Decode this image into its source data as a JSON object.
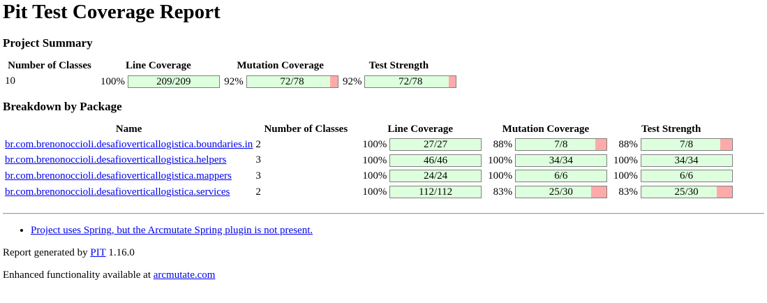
{
  "title": "Pit Test Coverage Report",
  "summary": {
    "heading": "Project Summary",
    "headers": {
      "classes": "Number of Classes",
      "line": "Line Coverage",
      "mutation": "Mutation Coverage",
      "strength": "Test Strength"
    },
    "num_classes": "10",
    "line_pct": "100%",
    "line_text": "209/209",
    "line_fraction": 1.0,
    "mutation_pct": "92%",
    "mutation_text": "72/78",
    "mutation_fraction": 0.923,
    "strength_pct": "92%",
    "strength_text": "72/78",
    "strength_fraction": 0.923
  },
  "breakdown": {
    "heading": "Breakdown by Package",
    "headers": {
      "name": "Name",
      "classes": "Number of Classes",
      "line": "Line Coverage",
      "mutation": "Mutation Coverage",
      "strength": "Test Strength"
    },
    "rows": [
      {
        "name": "br.com.brenonoccioli.desafioverticallogistica.boundaries.in",
        "classes": "2",
        "line_pct": "100%",
        "line_text": "27/27",
        "line_fraction": 1.0,
        "mutation_pct": "88%",
        "mutation_text": "7/8",
        "mutation_fraction": 0.875,
        "strength_pct": "88%",
        "strength_text": "7/8",
        "strength_fraction": 0.875
      },
      {
        "name": "br.com.brenonoccioli.desafioverticallogistica.helpers",
        "classes": "3",
        "line_pct": "100%",
        "line_text": "46/46",
        "line_fraction": 1.0,
        "mutation_pct": "100%",
        "mutation_text": "34/34",
        "mutation_fraction": 1.0,
        "strength_pct": "100%",
        "strength_text": "34/34",
        "strength_fraction": 1.0
      },
      {
        "name": "br.com.brenonoccioli.desafioverticallogistica.mappers",
        "classes": "3",
        "line_pct": "100%",
        "line_text": "24/24",
        "line_fraction": 1.0,
        "mutation_pct": "100%",
        "mutation_text": "6/6",
        "mutation_fraction": 1.0,
        "strength_pct": "100%",
        "strength_text": "6/6",
        "strength_fraction": 1.0
      },
      {
        "name": "br.com.brenonoccioli.desafioverticallogistica.services",
        "classes": "2",
        "line_pct": "100%",
        "line_text": "112/112",
        "line_fraction": 1.0,
        "mutation_pct": "83%",
        "mutation_text": "25/30",
        "mutation_fraction": 0.833,
        "strength_pct": "83%",
        "strength_text": "25/30",
        "strength_fraction": 0.833
      }
    ]
  },
  "notes": [
    "Project uses Spring, but the Arcmutate Spring plugin is not present."
  ],
  "footer": {
    "generated_prefix": "Report generated by ",
    "pit_link": "PIT",
    "version": " 1.16.0",
    "enhanced_prefix": "Enhanced functionality available at ",
    "arcmutate_link": "arcmutate.com"
  },
  "colors": {
    "covered": "#ddffdd",
    "uncovered": "#ffaaaa",
    "link": "#0000ee"
  }
}
